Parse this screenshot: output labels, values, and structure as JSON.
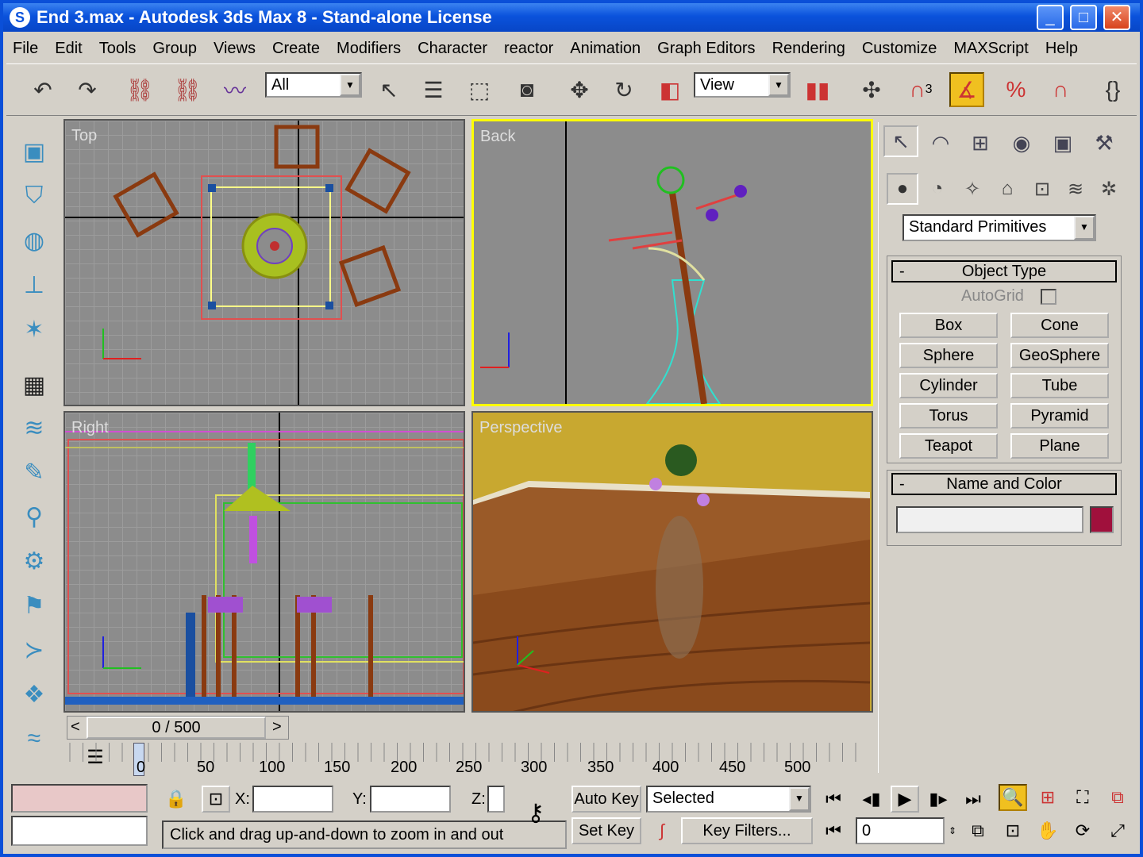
{
  "title": "End 3.max - Autodesk 3ds Max 8  - Stand-alone License",
  "window_controls": {
    "minimize": "_",
    "maximize": "□",
    "close": "✕"
  },
  "menu": [
    "File",
    "Edit",
    "Tools",
    "Group",
    "Views",
    "Create",
    "Modifiers",
    "Character",
    "reactor",
    "Animation",
    "Graph Editors",
    "Rendering",
    "Customize",
    "MAXScript",
    "Help"
  ],
  "toolbar": {
    "selection_filter": "All",
    "ref_coord": "View",
    "snap_label": "3"
  },
  "viewports": {
    "top": "Top",
    "back": "Back",
    "right": "Right",
    "perspective": "Perspective"
  },
  "axes": {
    "x": "x",
    "y": "y",
    "z": "z"
  },
  "command_panel": {
    "category": "Standard Primitives",
    "object_type": {
      "header": "Object Type",
      "collapse": "-",
      "autogrid": "AutoGrid",
      "buttons": [
        "Box",
        "Cone",
        "Sphere",
        "GeoSphere",
        "Cylinder",
        "Tube",
        "Torus",
        "Pyramid",
        "Teapot",
        "Plane"
      ]
    },
    "name_and_color": {
      "header": "Name and Color",
      "collapse": "-",
      "name_value": "",
      "color": "#a0103c"
    }
  },
  "time_slider": {
    "label": "0 / 500",
    "prev": "<",
    "next": ">"
  },
  "track_ticks": [
    "0",
    "50",
    "100",
    "150",
    "200",
    "250",
    "300",
    "350",
    "400",
    "450",
    "500"
  ],
  "status": {
    "x_label": "X:",
    "y_label": "Y:",
    "z_label": "Z:",
    "x_value": "",
    "y_value": "",
    "prompt": "Click and drag up-and-down to zoom in and out",
    "auto_key": "Auto Key",
    "set_key": "Set Key",
    "key_mode": "Selected",
    "key_filters": "Key Filters...",
    "frame": "0"
  }
}
